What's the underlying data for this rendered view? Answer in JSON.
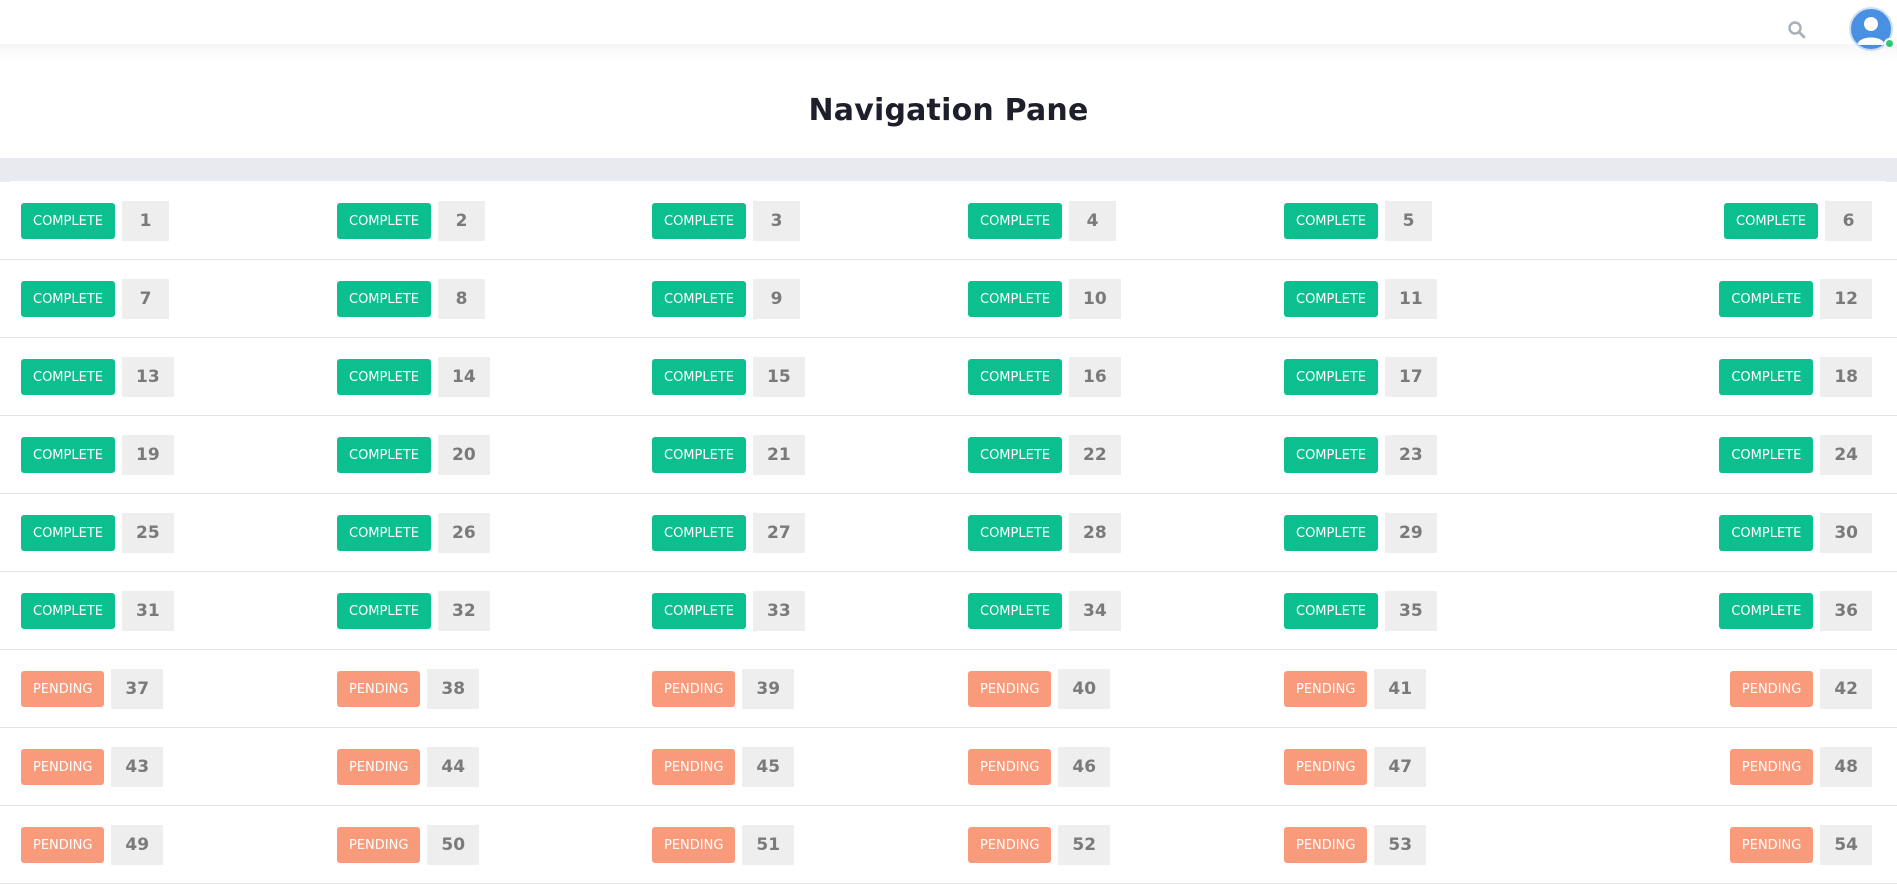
{
  "header": {
    "search_icon": "search-icon",
    "avatar_icon": "user-avatar-icon",
    "status_color": "#2ecc71"
  },
  "page": {
    "title": "Navigation Pane"
  },
  "colors": {
    "complete": "#0bbf8f",
    "pending": "#f99a7b",
    "number_bg": "#eeeeee"
  },
  "items": [
    {
      "status": "COMPLETE",
      "number": "1"
    },
    {
      "status": "COMPLETE",
      "number": "2"
    },
    {
      "status": "COMPLETE",
      "number": "3"
    },
    {
      "status": "COMPLETE",
      "number": "4"
    },
    {
      "status": "COMPLETE",
      "number": "5"
    },
    {
      "status": "COMPLETE",
      "number": "6"
    },
    {
      "status": "COMPLETE",
      "number": "7"
    },
    {
      "status": "COMPLETE",
      "number": "8"
    },
    {
      "status": "COMPLETE",
      "number": "9"
    },
    {
      "status": "COMPLETE",
      "number": "10"
    },
    {
      "status": "COMPLETE",
      "number": "11"
    },
    {
      "status": "COMPLETE",
      "number": "12"
    },
    {
      "status": "COMPLETE",
      "number": "13"
    },
    {
      "status": "COMPLETE",
      "number": "14"
    },
    {
      "status": "COMPLETE",
      "number": "15"
    },
    {
      "status": "COMPLETE",
      "number": "16"
    },
    {
      "status": "COMPLETE",
      "number": "17"
    },
    {
      "status": "COMPLETE",
      "number": "18"
    },
    {
      "status": "COMPLETE",
      "number": "19"
    },
    {
      "status": "COMPLETE",
      "number": "20"
    },
    {
      "status": "COMPLETE",
      "number": "21"
    },
    {
      "status": "COMPLETE",
      "number": "22"
    },
    {
      "status": "COMPLETE",
      "number": "23"
    },
    {
      "status": "COMPLETE",
      "number": "24"
    },
    {
      "status": "COMPLETE",
      "number": "25"
    },
    {
      "status": "COMPLETE",
      "number": "26"
    },
    {
      "status": "COMPLETE",
      "number": "27"
    },
    {
      "status": "COMPLETE",
      "number": "28"
    },
    {
      "status": "COMPLETE",
      "number": "29"
    },
    {
      "status": "COMPLETE",
      "number": "30"
    },
    {
      "status": "COMPLETE",
      "number": "31"
    },
    {
      "status": "COMPLETE",
      "number": "32"
    },
    {
      "status": "COMPLETE",
      "number": "33"
    },
    {
      "status": "COMPLETE",
      "number": "34"
    },
    {
      "status": "COMPLETE",
      "number": "35"
    },
    {
      "status": "COMPLETE",
      "number": "36"
    },
    {
      "status": "PENDING",
      "number": "37"
    },
    {
      "status": "PENDING",
      "number": "38"
    },
    {
      "status": "PENDING",
      "number": "39"
    },
    {
      "status": "PENDING",
      "number": "40"
    },
    {
      "status": "PENDING",
      "number": "41"
    },
    {
      "status": "PENDING",
      "number": "42"
    },
    {
      "status": "PENDING",
      "number": "43"
    },
    {
      "status": "PENDING",
      "number": "44"
    },
    {
      "status": "PENDING",
      "number": "45"
    },
    {
      "status": "PENDING",
      "number": "46"
    },
    {
      "status": "PENDING",
      "number": "47"
    },
    {
      "status": "PENDING",
      "number": "48"
    },
    {
      "status": "PENDING",
      "number": "49"
    },
    {
      "status": "PENDING",
      "number": "50"
    },
    {
      "status": "PENDING",
      "number": "51"
    },
    {
      "status": "PENDING",
      "number": "52"
    },
    {
      "status": "PENDING",
      "number": "53"
    },
    {
      "status": "PENDING",
      "number": "54"
    }
  ]
}
